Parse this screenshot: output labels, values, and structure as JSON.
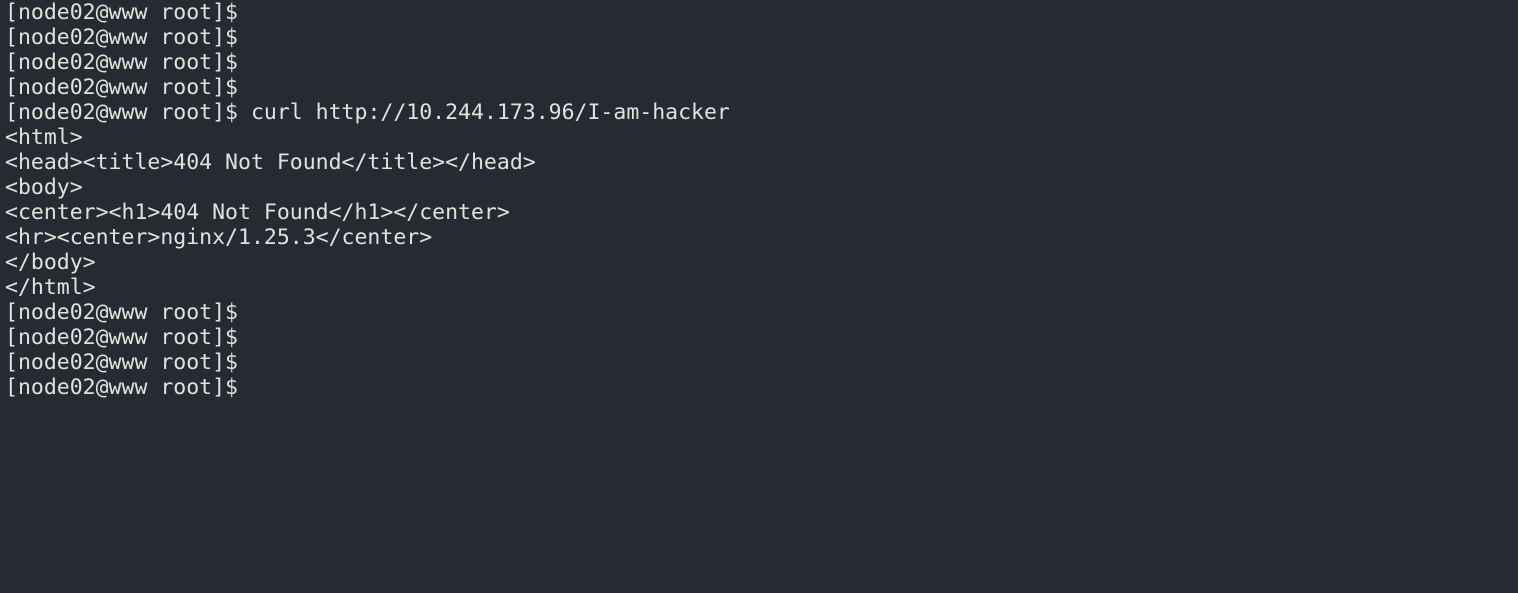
{
  "terminal": {
    "background_color": "#252a33",
    "foreground_color": "#e3e1dc",
    "prompt": "[node02@www root]$",
    "lines": [
      {
        "type": "prompt",
        "prompt": "[node02@www root]$",
        "command": ""
      },
      {
        "type": "prompt",
        "prompt": "[node02@www root]$",
        "command": ""
      },
      {
        "type": "prompt",
        "prompt": "[node02@www root]$",
        "command": ""
      },
      {
        "type": "prompt",
        "prompt": "[node02@www root]$",
        "command": ""
      },
      {
        "type": "prompt",
        "prompt": "[node02@www root]$",
        "command": " curl http://10.244.173.96/I-am-hacker"
      },
      {
        "type": "output",
        "text": "<html>"
      },
      {
        "type": "output",
        "text": "<head><title>404 Not Found</title></head>"
      },
      {
        "type": "output",
        "text": "<body>"
      },
      {
        "type": "output",
        "text": "<center><h1>404 Not Found</h1></center>"
      },
      {
        "type": "output",
        "text": "<hr><center>nginx/1.25.3</center>"
      },
      {
        "type": "output",
        "text": "</body>"
      },
      {
        "type": "output",
        "text": "</html>"
      },
      {
        "type": "prompt",
        "prompt": "[node02@www root]$",
        "command": ""
      },
      {
        "type": "prompt",
        "prompt": "[node02@www root]$",
        "command": ""
      },
      {
        "type": "prompt",
        "prompt": "[node02@www root]$",
        "command": ""
      },
      {
        "type": "prompt",
        "prompt": "[node02@www root]$",
        "command": ""
      }
    ],
    "command_detail": {
      "program": "curl",
      "url": "http://10.244.173.96/I-am-hacker",
      "scheme": "http",
      "host": "10.244.173.96",
      "path": "/I-am-hacker"
    },
    "response_detail": {
      "status": "404 Not Found",
      "server": "nginx/1.25.3"
    }
  }
}
